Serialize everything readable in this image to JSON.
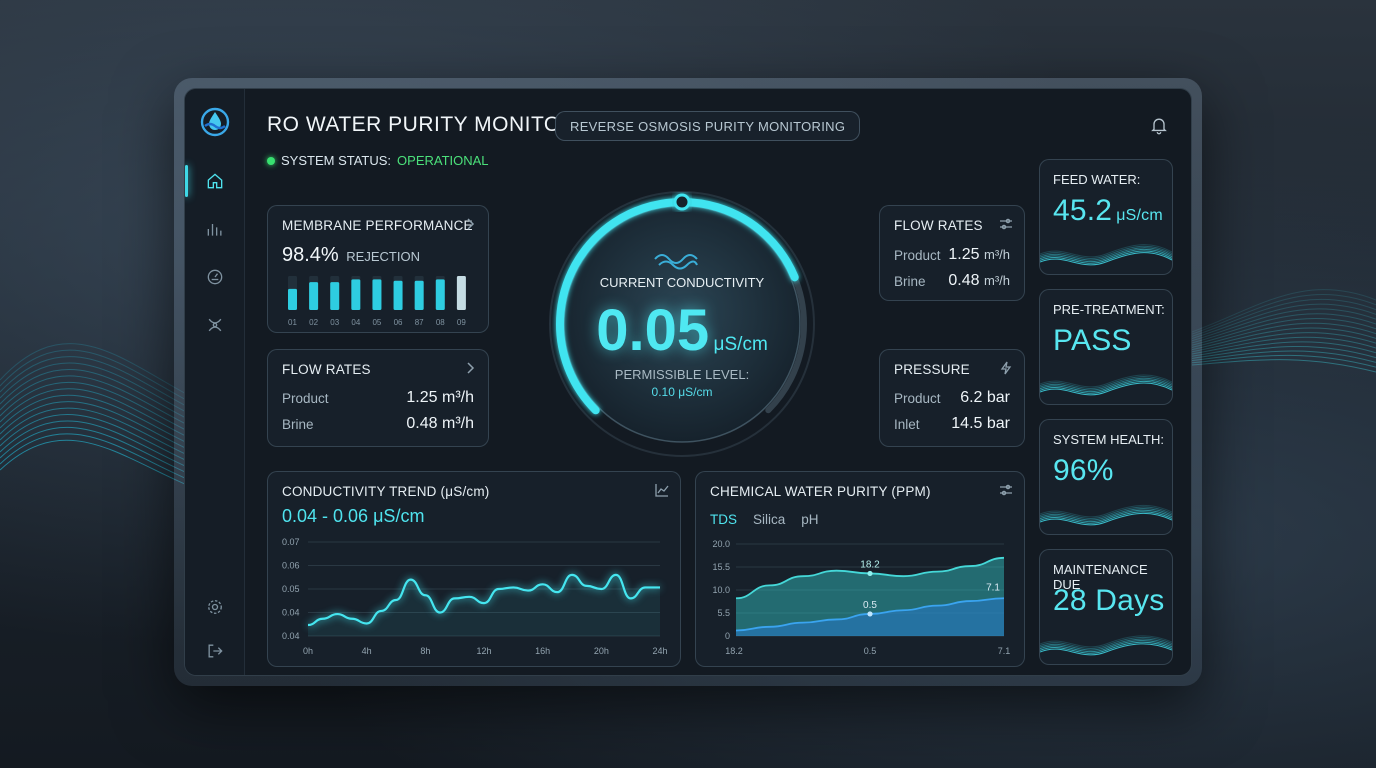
{
  "header": {
    "title": "RO WATER PURITY MONITOR",
    "subtitle": "REVERSE OSMOSIS PURITY MONITORING",
    "status_label": "SYSTEM STATUS:",
    "status_value": "OPERATIONAL"
  },
  "sidebar": {
    "items": [
      {
        "name": "home",
        "icon": "home-icon"
      },
      {
        "name": "analytics",
        "icon": "bar-chart-icon"
      },
      {
        "name": "gauge",
        "icon": "gauge-icon"
      },
      {
        "name": "filters",
        "icon": "filter-icon"
      },
      {
        "name": "settings",
        "icon": "gear-icon"
      },
      {
        "name": "logout",
        "icon": "logout-icon"
      }
    ]
  },
  "membrane": {
    "title": "MEMBRANE PERFORMANCE",
    "value": "98.4%",
    "label": "REJECTION",
    "bar_labels": [
      "01",
      "02",
      "03",
      "04",
      "05",
      "06",
      "87",
      "08",
      "09"
    ],
    "bar_levels": [
      0.62,
      0.82,
      0.82,
      0.9,
      0.9,
      0.86,
      0.86,
      0.9,
      1.0
    ]
  },
  "flow_left": {
    "title": "FLOW RATES",
    "product_label": "Product",
    "product_value": "1.25 m³/h",
    "brine_label": "Brine",
    "brine_value": "0.48 m³/h"
  },
  "gauge": {
    "title": "CURRENT CONDUCTIVITY",
    "value": "0.05",
    "unit": "μS/cm",
    "permissible_label": "PERMISSIBLE LEVEL:",
    "permissible_value": "0.10 μS/cm",
    "fraction": 0.75
  },
  "flow_right": {
    "title": "FLOW RATES",
    "product_label": "Product",
    "product_value": "1.25",
    "product_unit": "m³/h",
    "brine_label": "Brine",
    "brine_value": "0.48",
    "brine_unit": "m³/h"
  },
  "pressure": {
    "title": "PRESSURE",
    "product_label": "Product",
    "product_value": "6.2 bar",
    "inlet_label": "Inlet",
    "inlet_value": "14.5 bar"
  },
  "trend": {
    "title": "CONDUCTIVITY TREND (μS/cm)",
    "range": "0.04 - 0.06 μS/cm"
  },
  "chemical": {
    "title": "CHEMICAL WATER PURITY (PPM)",
    "tabs": [
      "TDS",
      "Silica",
      "pH"
    ],
    "active_tab": "TDS"
  },
  "side_cards": {
    "feed": {
      "title": "FEED WATER:",
      "value": "45.2",
      "unit": "μS/cm"
    },
    "pretreat": {
      "title": "PRE-TREATMENT:",
      "value": "PASS"
    },
    "health": {
      "title": "SYSTEM HEALTH:",
      "value": "96%"
    },
    "maintenance": {
      "title": "MAINTENANCE DUE",
      "value": "28 Days"
    }
  },
  "colors": {
    "accent": "#4fe3ee",
    "ok": "#4be07a",
    "panel": "#18212b"
  },
  "chart_data": [
    {
      "type": "line",
      "title": "CONDUCTIVITY TREND (μS/cm)",
      "x": [
        0,
        1,
        2,
        3,
        4,
        5,
        6,
        7,
        8,
        9,
        10,
        11,
        12,
        13,
        14,
        15,
        16,
        17,
        18,
        19,
        20,
        21,
        22,
        23,
        24
      ],
      "x_ticks": [
        "0h",
        "4h",
        "8h",
        "12h",
        "16h",
        "20h",
        "24h"
      ],
      "x_tick_values": [
        0,
        4,
        8,
        12,
        16,
        20,
        24
      ],
      "y_ticks": [
        "0.07",
        "0.06",
        "0.05",
        "0.04",
        "0.04"
      ],
      "series": [
        {
          "values": [
            0.0435,
            0.0455,
            0.047,
            0.0455,
            0.044,
            0.048,
            0.0515,
            0.058,
            0.053,
            0.0475,
            0.052,
            0.0525,
            0.0505,
            0.055,
            0.0555,
            0.0545,
            0.0565,
            0.054,
            0.0595,
            0.056,
            0.055,
            0.0595,
            0.052,
            0.0555,
            0.0555
          ]
        }
      ],
      "ylim": [
        0.04,
        0.07
      ],
      "grid": true
    },
    {
      "type": "area",
      "title": "CHEMICAL WATER PURITY (PPM)",
      "x_ticks": [
        "18.2",
        "0.5",
        "7.1"
      ],
      "y_ticks": [
        "20.0",
        "15.5",
        "10.0",
        "5.5",
        "0"
      ],
      "series": [
        {
          "values": [
            8.2,
            11.0,
            13.0,
            14.2,
            13.6,
            13.0,
            14.0,
            15.2,
            17.0
          ]
        },
        {
          "values": [
            1.2,
            2.0,
            2.9,
            3.6,
            4.8,
            5.6,
            6.6,
            7.6,
            8.2
          ]
        }
      ],
      "annotations": [
        "18.2",
        "0.5",
        "7.1"
      ],
      "ylim": [
        0,
        20
      ],
      "grid": true
    }
  ]
}
